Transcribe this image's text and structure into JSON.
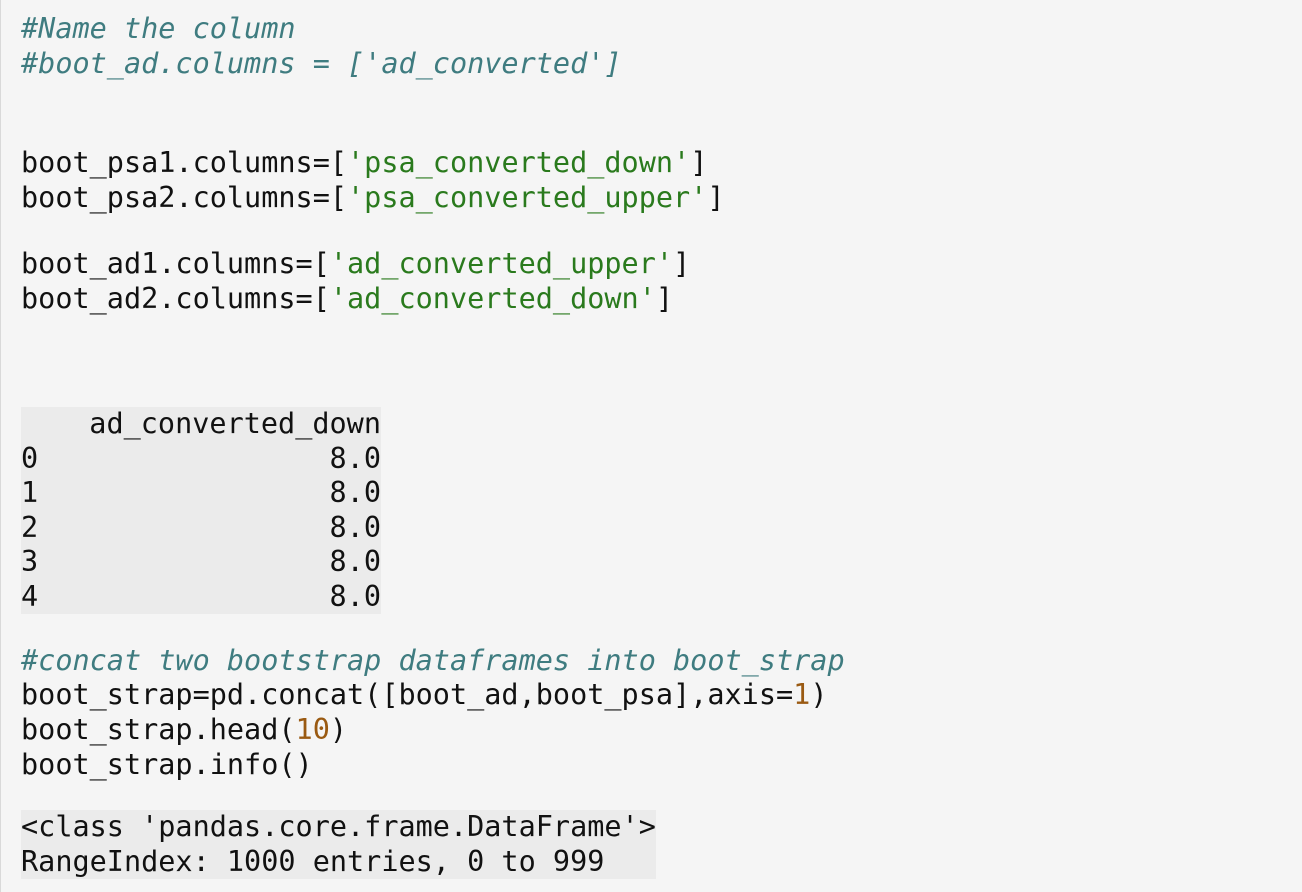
{
  "code_cell_1": {
    "comment1": "#Name the column",
    "comment2": "#boot_ad.columns = ['ad_converted']",
    "line1": {
      "pre": "boot_psa1.columns=[",
      "str": "'psa_converted_down'",
      "post": "]"
    },
    "line2": {
      "pre": "boot_psa2.columns=[",
      "str": "'psa_converted_upper'",
      "post": "]"
    },
    "line3": {
      "pre": "boot_ad1.columns=[",
      "str": "'ad_converted_upper'",
      "post": "]"
    },
    "line4": {
      "pre": "boot_ad2.columns=[",
      "str": "'ad_converted_down'",
      "post": "]"
    }
  },
  "output_table": {
    "column": "ad_converted_down",
    "rows": [
      {
        "index": "0",
        "value": "8.0"
      },
      {
        "index": "1",
        "value": "8.0"
      },
      {
        "index": "2",
        "value": "8.0"
      },
      {
        "index": "3",
        "value": "8.0"
      },
      {
        "index": "4",
        "value": "8.0"
      }
    ]
  },
  "code_cell_2": {
    "comment": "#concat two bootstrap dataframes into boot_strap",
    "line1": {
      "pre": "boot_strap=pd.concat([boot_ad,boot_psa],axis=",
      "num": "1",
      "post": ")"
    },
    "line2": {
      "pre": "boot_strap.head(",
      "num": "10",
      "post": ")"
    },
    "line3": "boot_strap.info()"
  },
  "info_output": {
    "line1": "<class 'pandas.core.frame.DataFrame'>",
    "line2": "RangeIndex: 1000 entries, 0 to 999"
  }
}
